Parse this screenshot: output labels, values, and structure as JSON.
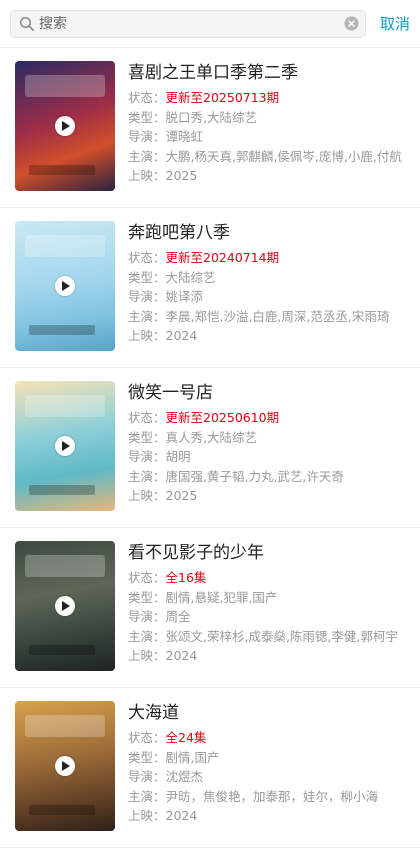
{
  "search": {
    "placeholder": "搜索",
    "cancel_label": "取消"
  },
  "results": [
    {
      "title": "喜剧之王单口季第二季",
      "status_label": "状态：",
      "status": "更新至20250713期",
      "type_label": "类型：",
      "type": "脱口秀,大陆综艺",
      "director_label": "导演：",
      "director": "谭晓虹",
      "cast_label": "主演：",
      "cast": "大鹏,杨天真,郭麒麟,侯佩岑,庞博,小鹿,付航",
      "release_label": "上映：",
      "release": "2025"
    },
    {
      "title": "奔跑吧第八季",
      "status_label": "状态：",
      "status": "更新至20240714期",
      "type_label": "类型：",
      "type": "大陆综艺",
      "director_label": "导演：",
      "director": "姚译添",
      "cast_label": "主演：",
      "cast": "李晨,郑恺,沙溢,白鹿,周深,范丞丞,宋雨琦",
      "release_label": "上映：",
      "release": "2024"
    },
    {
      "title": "微笑一号店",
      "status_label": "状态：",
      "status": "更新至20250610期",
      "type_label": "类型：",
      "type": "真人秀,大陆综艺",
      "director_label": "导演：",
      "director": "胡明",
      "cast_label": "主演：",
      "cast": "唐国强,黄子韬,力丸,武艺,许天奇",
      "release_label": "上映：",
      "release": "2025"
    },
    {
      "title": "看不见影子的少年",
      "status_label": "状态：",
      "status": "全16集",
      "type_label": "类型：",
      "type": "剧情,悬疑,犯罪,国产",
      "director_label": "导演：",
      "director": "周全",
      "cast_label": "主演：",
      "cast": "张颂文,荣梓杉,成泰燊,陈雨锶,李健,郭柯宇",
      "release_label": "上映：",
      "release": "2024"
    },
    {
      "title": "大海道",
      "status_label": "状态：",
      "status": "全24集",
      "type_label": "类型：",
      "type": "剧情,国产",
      "director_label": "导演：",
      "director": "沈煜杰",
      "cast_label": "主演：",
      "cast": "尹昉，焦俊艳，加泰那，娃尔，柳小海",
      "release_label": "上映：",
      "release": "2024"
    }
  ],
  "colors": {
    "accent": "#0aa0c8",
    "status": "#e60012",
    "meta_text": "#999999",
    "title_text": "#222222"
  }
}
